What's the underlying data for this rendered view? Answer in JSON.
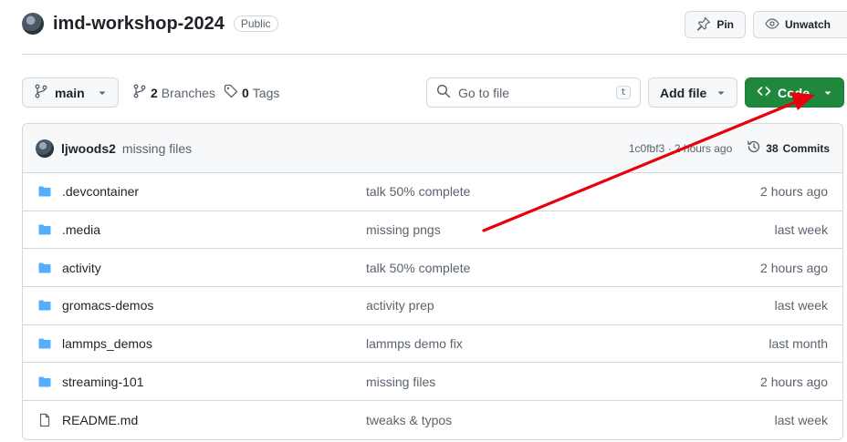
{
  "repo": {
    "name": "imd-workshop-2024",
    "visibility": "Public"
  },
  "top_actions": {
    "pin_label": "Pin",
    "watch_label": "Unwatch"
  },
  "toolbar": {
    "branch": "main",
    "branches_count": "2",
    "branches_label": "Branches",
    "tags_count": "0",
    "tags_label": "Tags",
    "search_placeholder": "Go to file",
    "search_shortcut": "t",
    "add_file_label": "Add file",
    "code_label": "Code"
  },
  "latest_commit": {
    "author": "ljwoods2",
    "message": "missing files",
    "meta": "1c0fbf3 · 2 hours ago",
    "commits_count": "38",
    "commits_label": "Commits"
  },
  "files": [
    {
      "type": "folder",
      "name": ".devcontainer",
      "commit": "talk 50% complete",
      "date": "2 hours ago"
    },
    {
      "type": "folder",
      "name": ".media",
      "commit": "missing pngs",
      "date": "last week"
    },
    {
      "type": "folder",
      "name": "activity",
      "commit": "talk 50% complete",
      "date": "2 hours ago"
    },
    {
      "type": "folder",
      "name": "gromacs-demos",
      "commit": "activity prep",
      "date": "last week"
    },
    {
      "type": "folder",
      "name": "lammps_demos",
      "commit": "lammps demo fix",
      "date": "last month"
    },
    {
      "type": "folder",
      "name": "streaming-101",
      "commit": "missing files",
      "date": "2 hours ago"
    },
    {
      "type": "file",
      "name": "README.md",
      "commit": "tweaks & typos",
      "date": "last week"
    }
  ],
  "colors": {
    "folder": "#54aeff",
    "code_green": "#1f883d",
    "annotation_arrow": "#e8000b"
  },
  "icons": {
    "folder": "folder-icon",
    "file": "file-icon"
  }
}
